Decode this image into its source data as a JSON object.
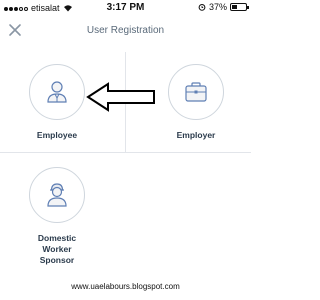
{
  "status_bar": {
    "carrier": "etisalat",
    "time": "3:17 PM",
    "battery": "37%",
    "battery_level": 0.37
  },
  "header": {
    "title": "User Registration",
    "close_icon": "close-icon"
  },
  "options": [
    {
      "label": "Employee",
      "icon": "person-icon"
    },
    {
      "label": "Employer",
      "icon": "briefcase-icon"
    },
    {
      "label": "Domestic\nWorker\nSponsor",
      "icon": "person-icon"
    }
  ],
  "annotation": {
    "icon": "left-arrow-icon"
  },
  "footer": {
    "text": "www.uaelabours.blogspot.com"
  },
  "colors": {
    "icon_blue": "#5f7fb4",
    "border": "#cfd6dd",
    "divider": "#e2e5ea"
  }
}
